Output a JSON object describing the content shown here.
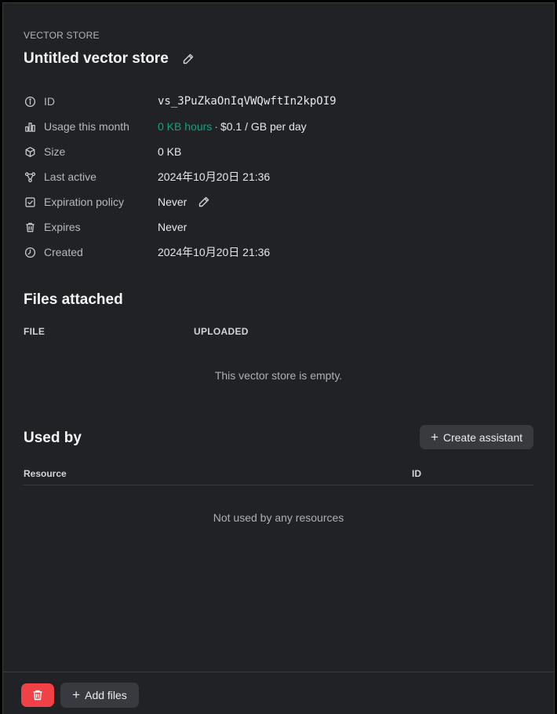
{
  "header": {
    "eyebrow": "VECTOR STORE",
    "title": "Untitled vector store"
  },
  "properties": [
    {
      "icon": "info-icon",
      "label": "ID",
      "value": "vs_3PuZkaOnIqVWQwftIn2kpOI9"
    },
    {
      "icon": "bar-chart-icon",
      "label": "Usage this month",
      "value_highlight": "0 KB hours",
      "value_separator": "·",
      "value_rest": "$0.1 / GB per day"
    },
    {
      "icon": "cube-icon",
      "label": "Size",
      "value": "0 KB"
    },
    {
      "icon": "nodes-icon",
      "label": "Last active",
      "value": "2024年10月20日 21:36"
    },
    {
      "icon": "calendar-check-icon",
      "label": "Expiration policy",
      "value": "Never"
    },
    {
      "icon": "trash-icon",
      "label": "Expires",
      "value": "Never"
    },
    {
      "icon": "clock-icon",
      "label": "Created",
      "value": "2024年10月20日 21:36"
    }
  ],
  "files": {
    "heading": "Files attached",
    "columns": [
      "FILE",
      "UPLOADED"
    ],
    "empty_text": "This vector store is empty."
  },
  "used_by": {
    "heading": "Used by",
    "create_button": "Create assistant",
    "columns": [
      "Resource",
      "ID"
    ],
    "empty_text": "Not used by any resources"
  },
  "footer": {
    "add_files_label": "Add files"
  },
  "colors": {
    "accent_green": "#10a37f",
    "danger_red": "#ef4146",
    "panel_bg": "#212225"
  }
}
